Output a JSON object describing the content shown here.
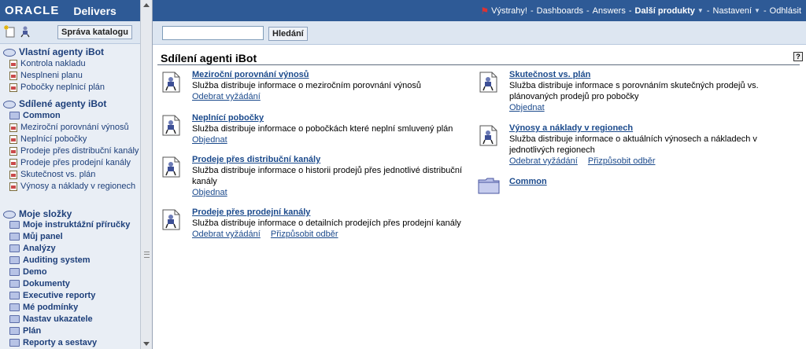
{
  "brand": {
    "oracle": "ORACLE",
    "product": "Delivers"
  },
  "left_toolbar": {
    "catalog_button": "Správa katalogu"
  },
  "sidebar": {
    "own_agents": {
      "label": "Vlastní agenty iBot",
      "items": [
        "Kontrola nakladu",
        "Nesplneni planu",
        "Pobočky neplnicí plán"
      ]
    },
    "shared_agents": {
      "label": "Sdílené agenty iBot",
      "folder": "Common",
      "items": [
        "Meziroční porovnání výnosů",
        "Neplnící pobočky",
        "Prodeje přes distribuční kanály",
        "Prodeje přes prodejní kanály",
        "Skutečnost vs. plán",
        "Výnosy a náklady v regionech"
      ]
    },
    "my_folders": {
      "label": "Moje složky",
      "items": [
        "Moje instruktážní příručky",
        "Můj panel",
        "Analýzy",
        "Auditing system",
        "Demo",
        "Dokumenty",
        "Executive reporty",
        "Mé podmínky",
        "Nastav ukazatele",
        "Plán",
        "Reporty a sestavy"
      ]
    }
  },
  "topbar": {
    "alerts": "Výstrahy!",
    "dashboards": "Dashboards",
    "answers": "Answers",
    "more_products": "Další produkty",
    "settings": "Nastavení",
    "logout": "Odhlásit",
    "separator": "-"
  },
  "search": {
    "value": "",
    "button": "Hledání"
  },
  "main": {
    "title": "Sdílení agenti iBot",
    "help": "?",
    "agents": [
      {
        "title": "Meziroční porovnání výnosů",
        "desc": "Služba distribuje informace o meziročním porovnání výnosů",
        "actions": [
          "Odebrat vyžádání"
        ]
      },
      {
        "title": "Neplnící pobočky",
        "desc": "Služba distribuje informace o pobočkách které neplní smluvený plán",
        "actions": [
          "Objednat"
        ]
      },
      {
        "title": "Prodeje přes distribuční kanály",
        "desc": "Služba distribuje informace o historii prodejů přes jednotlivé distribuční kanály",
        "actions": [
          "Objednat"
        ]
      },
      {
        "title": "Prodeje přes prodejní kanály",
        "desc": "Služba distribuje informace o detailních prodejích přes prodejní kanály",
        "actions": [
          "Odebrat vyžádání",
          "Přizpůsobit odběr"
        ]
      },
      {
        "title": "Skutečnost vs. plán",
        "desc": "Služba distribuje informace s porovnáním skutečných prodejů vs. plánovaných prodejů pro pobočky",
        "actions": [
          "Objednat"
        ]
      },
      {
        "title": "Výnosy a náklady v regionech",
        "desc": "Služba distribuje informace o aktuálních výnosech a nákladech v jednotlivých regionech",
        "actions": [
          "Odebrat vyžádání",
          "Přizpůsobit odběr"
        ]
      }
    ],
    "folder": "Common"
  },
  "colors": {
    "brand_blue": "#2e5a96",
    "link": "#1b4a8c",
    "sidebar_bg": "#e9eef5"
  }
}
